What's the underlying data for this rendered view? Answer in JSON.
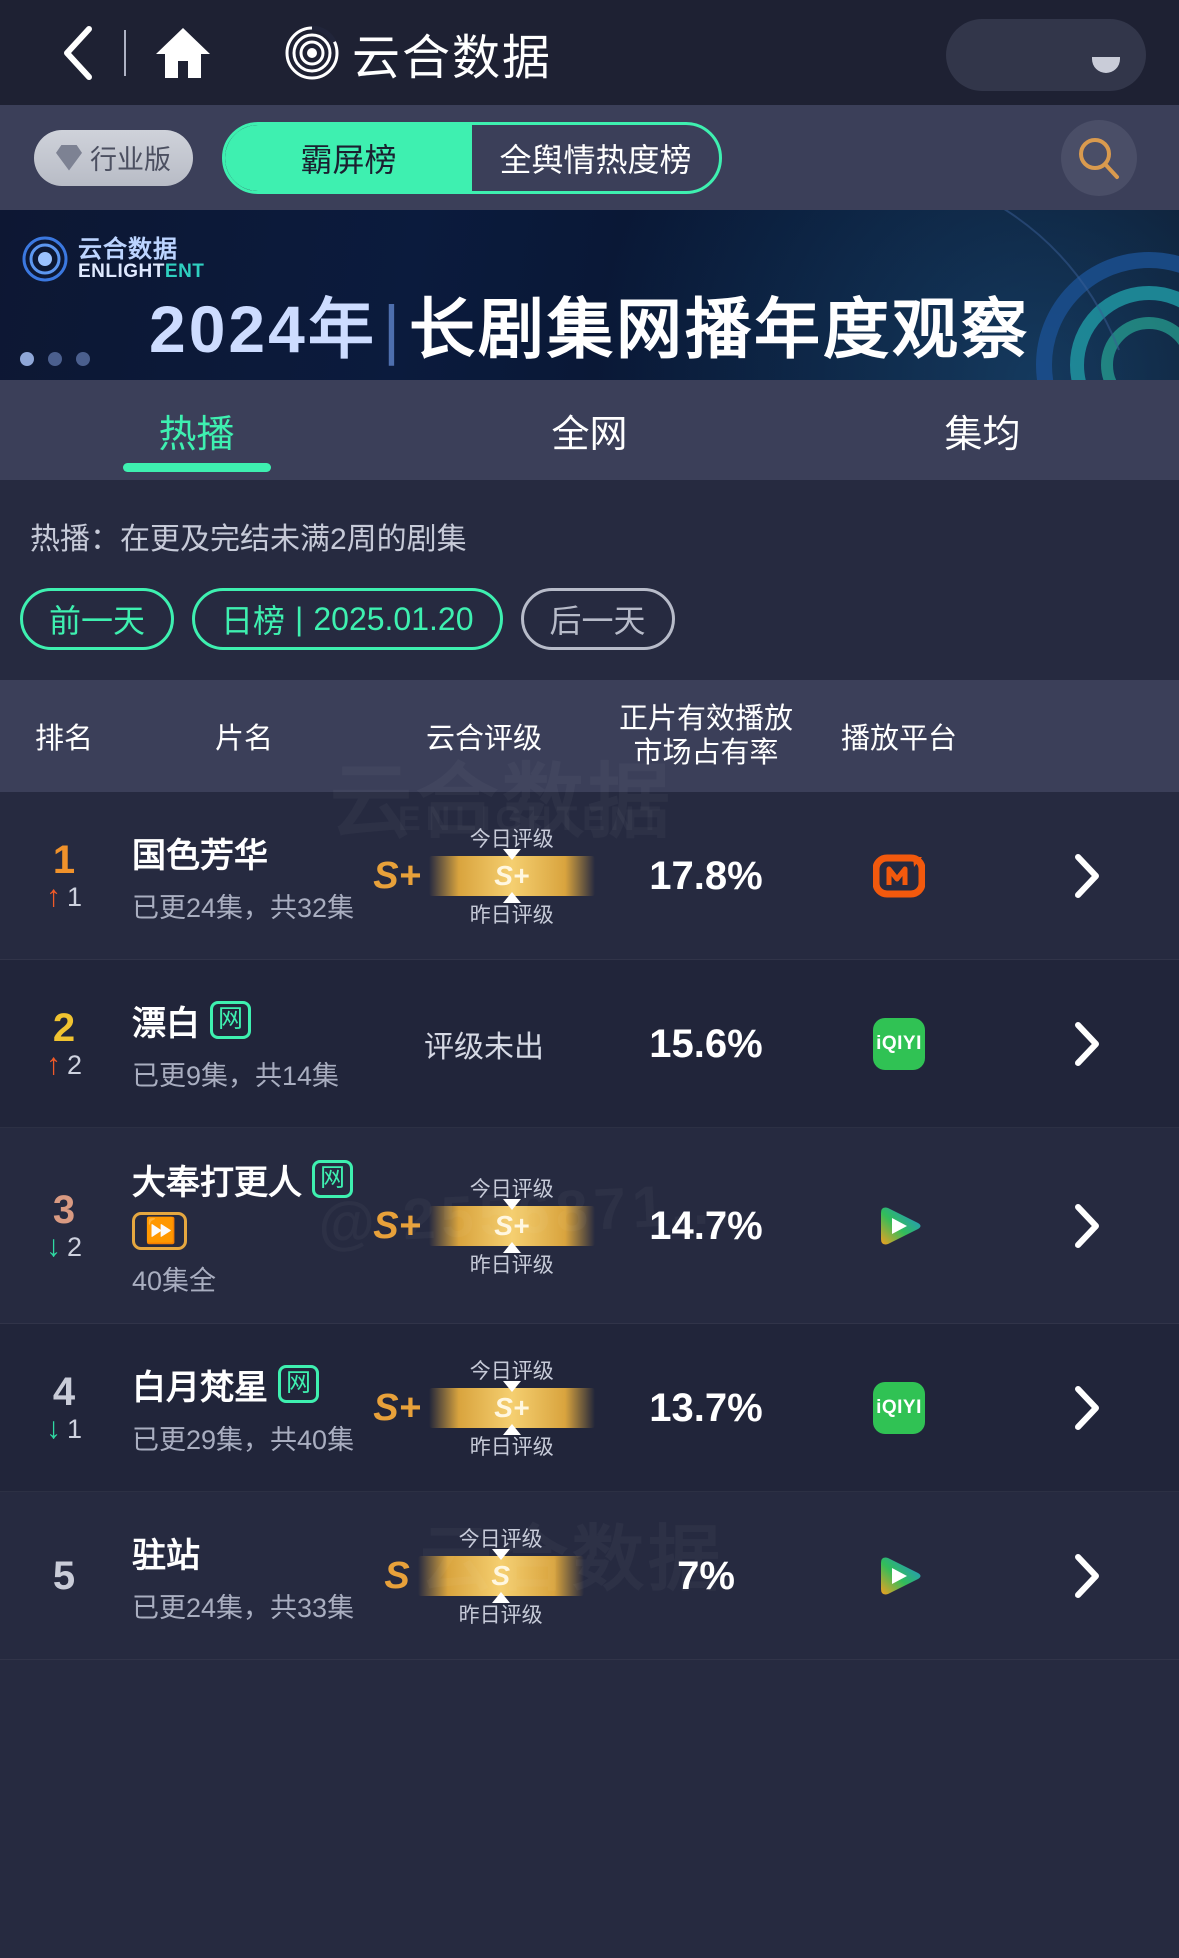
{
  "navbar": {
    "back_icon": "chevron-left-icon",
    "home_icon": "home-icon",
    "brand_logo": "yunhe-logo-icon",
    "brand_title": "云合数据"
  },
  "toolbar": {
    "industry_badge": "行业版",
    "segments": [
      {
        "label": "霸屏榜",
        "active": true
      },
      {
        "label": "全舆情热度榜",
        "active": false
      }
    ],
    "search_icon": "search-icon"
  },
  "banner": {
    "logo_cn": "云合数据",
    "logo_en_a": "ENLIGHT",
    "logo_en_b": "ENT",
    "title_year": "2024年",
    "title_sep": "|",
    "title_main": "长剧集网播年度观察",
    "dots": 3,
    "active_dot": 0
  },
  "main_tabs": [
    {
      "label": "热播",
      "active": true
    },
    {
      "label": "全网",
      "active": false
    },
    {
      "label": "集均",
      "active": false
    }
  ],
  "filters": {
    "description": "热播：在更及完结未满2周的剧集",
    "prev_day": "前一天",
    "rank_type": "日榜",
    "separator": "|",
    "date": "2025.01.20",
    "next_day": "后一天"
  },
  "table": {
    "headers": {
      "rank": "排名",
      "title": "片名",
      "rating": "云合评级",
      "share_line1": "正片有效播放",
      "share_line2": "市场占有率",
      "platform": "播放平台"
    },
    "rating_labels": {
      "today": "今日评级",
      "yesterday": "昨日评级"
    },
    "rows": [
      {
        "rank": "1",
        "rank_color": "#f0922b",
        "delta_dir": "up",
        "delta_arrow": "↑",
        "delta_value": "1",
        "title": "国色芳华",
        "web_tag": "",
        "fast_tag": "",
        "subtitle": "已更24集，共32集",
        "rating_letter": "S+",
        "rating_gauge_value": "S+",
        "rating_text": "",
        "share": "17.8%",
        "platform": "mangotv",
        "platform_label": "芒果TV",
        "chevron": "chevron-right-icon"
      },
      {
        "rank": "2",
        "rank_color": "#f0c330",
        "delta_dir": "up",
        "delta_arrow": "↑",
        "delta_value": "2",
        "title": "漂白",
        "web_tag": "网",
        "fast_tag": "",
        "subtitle": "已更9集，共14集",
        "rating_letter": "",
        "rating_gauge_value": "",
        "rating_text": "评级未出",
        "share": "15.6%",
        "platform": "iqiyi",
        "platform_label": "iQIYI",
        "chevron": "chevron-right-icon"
      },
      {
        "rank": "3",
        "rank_color": "#d99a82",
        "delta_dir": "down",
        "delta_arrow": "↓",
        "delta_value": "2",
        "title": "大奉打更人",
        "web_tag": "网",
        "fast_tag": "⏩",
        "subtitle": "40集全",
        "rating_letter": "S+",
        "rating_gauge_value": "S+",
        "rating_text": "",
        "share": "14.7%",
        "platform": "youku",
        "platform_label": "优酷",
        "chevron": "chevron-right-icon"
      },
      {
        "rank": "4",
        "rank_color": "#c9ccd8",
        "delta_dir": "down",
        "delta_arrow": "↓",
        "delta_value": "1",
        "title": "白月梵星",
        "web_tag": "网",
        "fast_tag": "",
        "subtitle": "已更29集，共40集",
        "rating_letter": "S+",
        "rating_gauge_value": "S+",
        "rating_text": "",
        "share": "13.7%",
        "platform": "iqiyi",
        "platform_label": "iQIYI",
        "chevron": "chevron-right-icon"
      },
      {
        "rank": "5",
        "rank_color": "#c9ccd8",
        "delta_dir": "none",
        "delta_arrow": "",
        "delta_value": "",
        "title": "驻站",
        "web_tag": "",
        "fast_tag": "",
        "subtitle": "已更24集，共33集",
        "rating_letter": "S",
        "rating_gauge_value": "S",
        "rating_text": "",
        "share": "7%",
        "platform": "youku",
        "platform_label": "优酷",
        "chevron": "chevron-right-icon"
      }
    ]
  },
  "watermarks": {
    "w1": "云合数据",
    "w2": "ENLIGHTENT",
    "w3": "@ 2556871...",
    "w4": "云合数据"
  },
  "colors": {
    "accent": "#3ef0b0",
    "gold": "#e8a13a",
    "up": "#f05a28",
    "down": "#2fd9a2",
    "bg": "#262a40",
    "bg_alt": "#21253a",
    "header_bg": "#3b3f59"
  }
}
